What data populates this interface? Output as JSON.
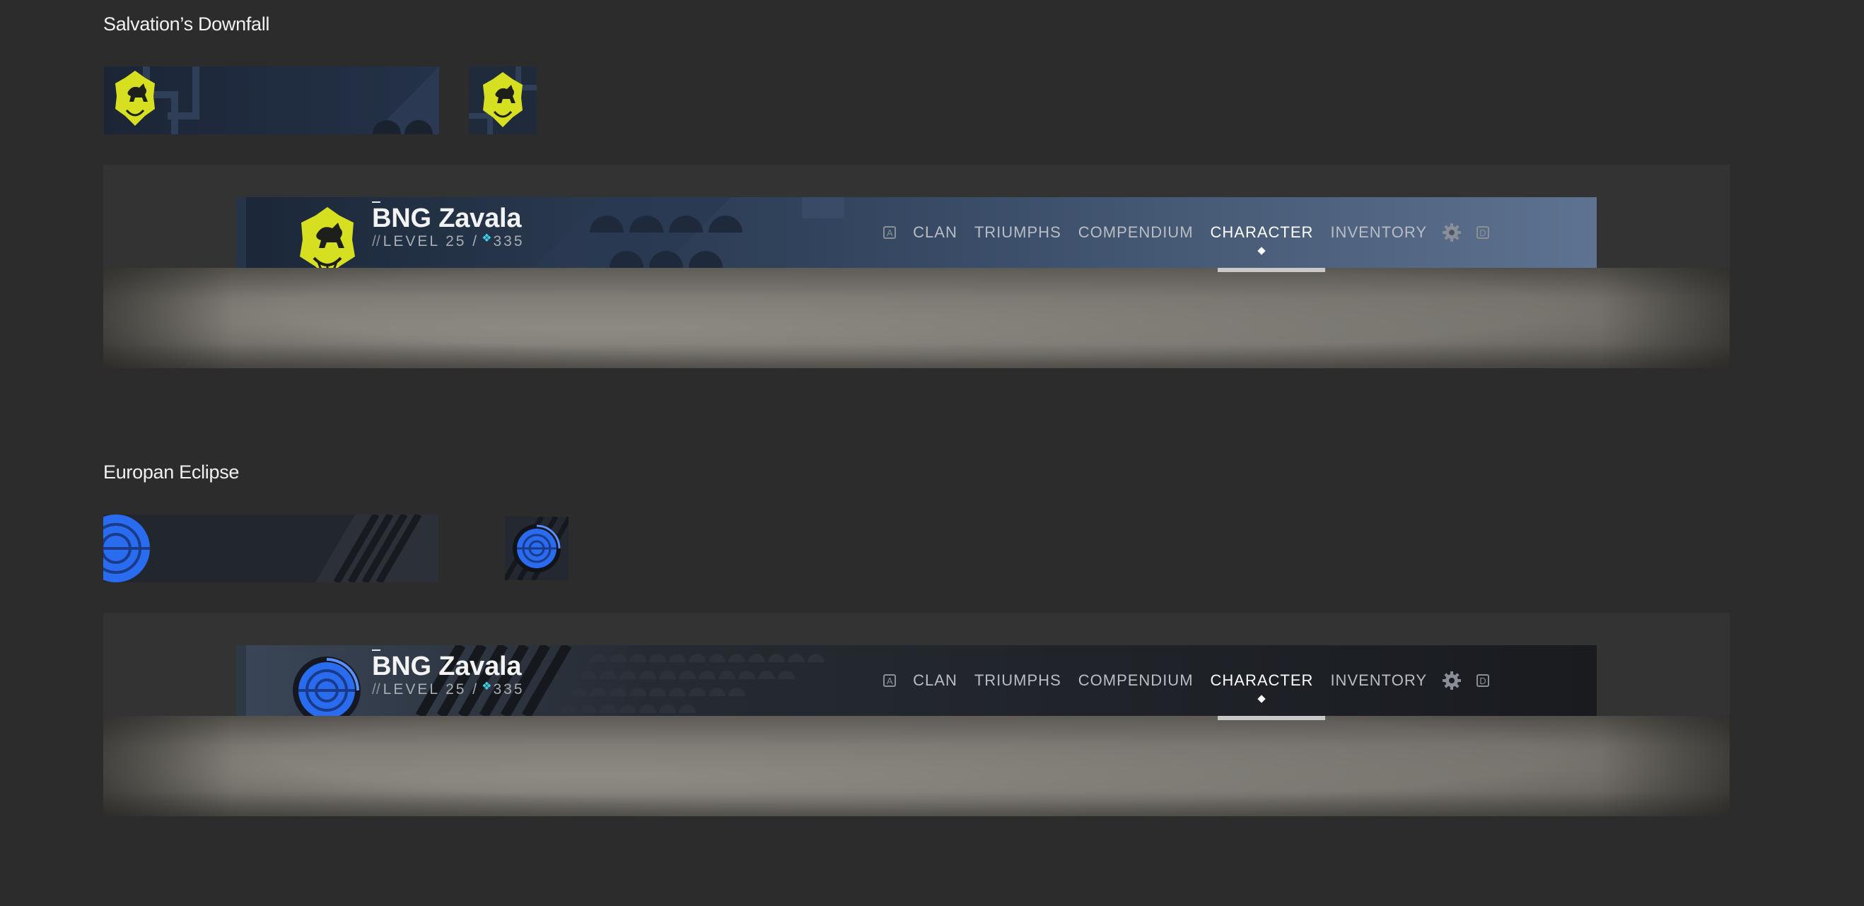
{
  "themes": [
    {
      "title": "Salvation’s Downfall",
      "emblem_icon": "winged-lion-icon",
      "colors": {
        "emblem": "#d6e021",
        "banner_left": "#1b2738",
        "banner_right": "#5e7391"
      }
    },
    {
      "title": "Europan Eclipse",
      "emblem_icon": "concentric-orb-icon",
      "colors": {
        "emblem": "#2a6cf0",
        "banner_left": "#22262c",
        "banner_right": "#191b1f"
      }
    }
  ],
  "player": {
    "name": "BNG Zavala",
    "level_prefix": "//",
    "level_label": "LEVEL 25 /",
    "light_icon": "light-diamond-icon",
    "light": "335"
  },
  "nav": {
    "left_key": "A",
    "tabs": [
      "CLAN",
      "TRIUMPHS",
      "COMPENDIUM",
      "CHARACTER",
      "INVENTORY"
    ],
    "active_tab": "CHARACTER",
    "settings_icon": "gear-icon",
    "right_key": "D"
  }
}
